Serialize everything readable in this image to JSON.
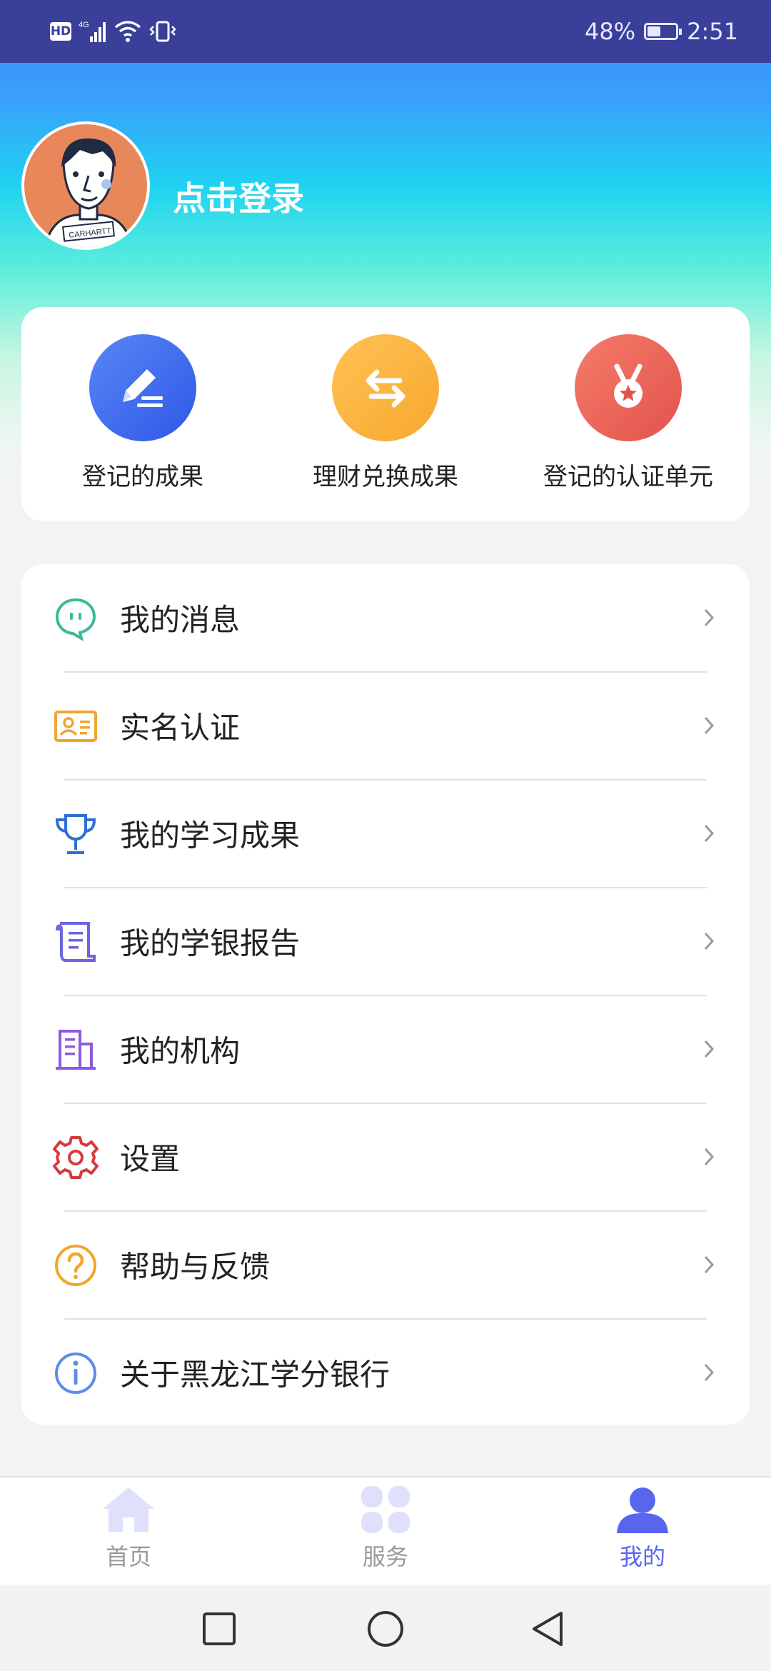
{
  "status_bar": {
    "network": "4G",
    "battery_percent_text": "48%",
    "battery_level": 0.48,
    "time": "2:51"
  },
  "profile": {
    "login_label": "点击登录"
  },
  "quick_actions": [
    {
      "label": "登记的成果",
      "icon": "edit-icon",
      "color": "#3f6ef0"
    },
    {
      "label": "理财兑换成果",
      "icon": "exchange-icon",
      "color": "#fbb238"
    },
    {
      "label": "登记的认证单元",
      "icon": "medal-icon",
      "color": "#ea5f55"
    }
  ],
  "menu": {
    "items": [
      {
        "label": "我的消息",
        "icon": "message-icon",
        "color": "#3bb99a"
      },
      {
        "label": "实名认证",
        "icon": "id-card-icon",
        "color": "#f0a432"
      },
      {
        "label": "我的学习成果",
        "icon": "trophy-icon",
        "color": "#2f6fd6"
      },
      {
        "label": "我的学银报告",
        "icon": "report-scroll-icon",
        "color": "#6b66e0"
      },
      {
        "label": "我的机构",
        "icon": "building-icon",
        "color": "#8a5be0"
      },
      {
        "label": "设置",
        "icon": "gear-icon",
        "color": "#d6393f"
      },
      {
        "label": "帮助与反馈",
        "icon": "help-icon",
        "color": "#f3a52a"
      },
      {
        "label": "关于黑龙江学分银行",
        "icon": "info-icon",
        "color": "#5b8ee6"
      }
    ]
  },
  "tabbar": {
    "tabs": [
      {
        "label": "首页",
        "icon": "home-icon",
        "active": false
      },
      {
        "label": "服务",
        "icon": "grid-icon",
        "active": false
      },
      {
        "label": "我的",
        "icon": "user-icon",
        "active": true
      }
    ],
    "active_color": "#5866ef",
    "inactive_color": "#999999"
  }
}
